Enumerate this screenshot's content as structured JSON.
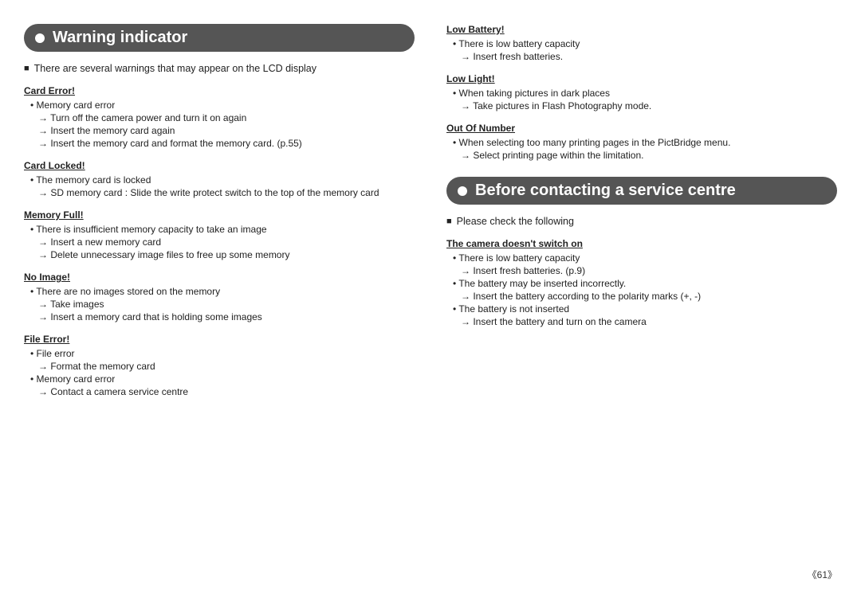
{
  "left": {
    "header": "Warning indicator",
    "intro": "There are several warnings that may appear on the LCD display",
    "sections": [
      {
        "title": "Card Error!",
        "items": [
          {
            "type": "bullet",
            "text": "Memory card error"
          },
          {
            "type": "arrow",
            "text": "Turn off the camera power and turn it on again"
          },
          {
            "type": "arrow",
            "text": "Insert the memory card again"
          },
          {
            "type": "arrow",
            "text": "Insert the memory card and format the memory card. (p.55)"
          }
        ]
      },
      {
        "title": "Card Locked!",
        "items": [
          {
            "type": "bullet",
            "text": "The memory card is locked"
          },
          {
            "type": "arrow",
            "text": "SD memory card : Slide the write protect switch to the top of the memory card"
          }
        ]
      },
      {
        "title": "Memory Full!",
        "items": [
          {
            "type": "bullet",
            "text": "There is insufficient memory capacity to take an image"
          },
          {
            "type": "arrow",
            "text": "Insert a new memory card"
          },
          {
            "type": "arrow",
            "text": "Delete unnecessary image files to free up some memory"
          }
        ]
      },
      {
        "title": "No Image!",
        "items": [
          {
            "type": "bullet",
            "text": "There are no images stored on the memory"
          },
          {
            "type": "arrow",
            "text": "Take images"
          },
          {
            "type": "arrow",
            "text": "Insert a memory card that is holding some images"
          }
        ]
      },
      {
        "title": "File Error!",
        "items": [
          {
            "type": "bullet",
            "text": "File error"
          },
          {
            "type": "arrow",
            "text": "Format the memory card"
          },
          {
            "type": "bullet",
            "text": "Memory card error"
          },
          {
            "type": "arrow",
            "text": "Contact a camera service centre"
          }
        ]
      }
    ]
  },
  "right_top": {
    "sections": [
      {
        "title": "Low Battery!",
        "items": [
          {
            "type": "bullet",
            "text": "There is low battery capacity"
          },
          {
            "type": "arrow",
            "text": "Insert fresh batteries."
          }
        ]
      },
      {
        "title": "Low Light!",
        "items": [
          {
            "type": "bullet",
            "text": "When taking pictures in dark places"
          },
          {
            "type": "arrow",
            "text": "Take pictures in Flash Photography mode."
          }
        ]
      },
      {
        "title": "Out Of Number",
        "items": [
          {
            "type": "bullet",
            "text": "When selecting too many printing pages in the PictBridge menu."
          },
          {
            "type": "arrow",
            "text": "Select printing page within the limitation."
          }
        ]
      }
    ]
  },
  "right_bottom": {
    "header": "Before contacting a service centre",
    "intro": "Please check the following",
    "sections": [
      {
        "title": "The camera doesn't switch on",
        "items": [
          {
            "type": "bullet",
            "text": "There is low battery capacity"
          },
          {
            "type": "arrow",
            "text": "Insert fresh batteries. (p.9)"
          },
          {
            "type": "bullet",
            "text": "The battery may be inserted incorrectly."
          },
          {
            "type": "arrow",
            "text": "Insert the battery according to the polarity marks (+, -)"
          },
          {
            "type": "bullet",
            "text": "The battery is not inserted"
          },
          {
            "type": "arrow",
            "text": "Insert the battery and turn on the camera"
          }
        ]
      }
    ]
  },
  "page_number": "《61》"
}
